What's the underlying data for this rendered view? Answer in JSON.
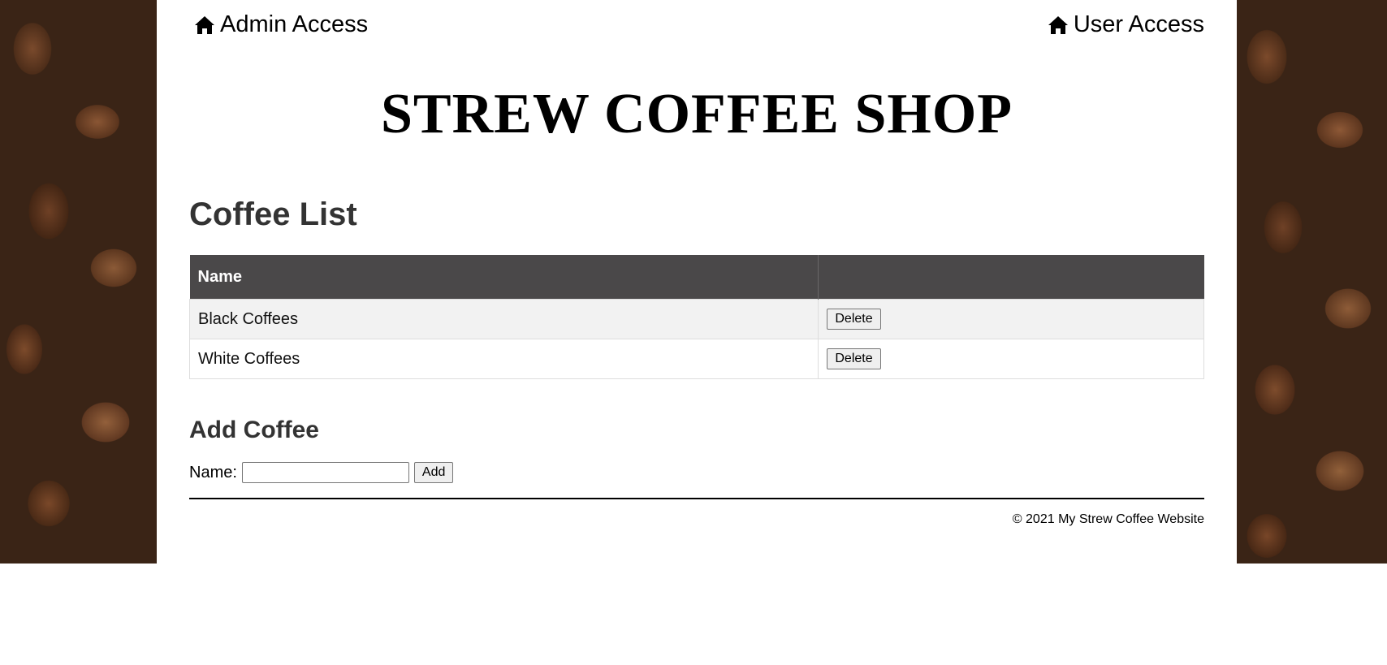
{
  "nav": {
    "admin_label": "Admin Access",
    "user_label": "User Access",
    "icon": "home-icon"
  },
  "site": {
    "title": "STREW COFFEE SHOP"
  },
  "coffee_list": {
    "heading": "Coffee List",
    "columns": [
      "Name",
      ""
    ],
    "rows": [
      {
        "name": "Black Coffees",
        "action": "Delete"
      },
      {
        "name": "White Coffees",
        "action": "Delete"
      }
    ]
  },
  "add_coffee": {
    "heading": "Add Coffee",
    "name_label": "Name:",
    "name_value": "",
    "button_label": "Add"
  },
  "footer": {
    "text": "© 2021 My Strew Coffee Website"
  },
  "colors": {
    "table_header_bg": "#4a4849",
    "row_stripe_bg": "#f2f2f2",
    "heading_text": "#333333"
  }
}
